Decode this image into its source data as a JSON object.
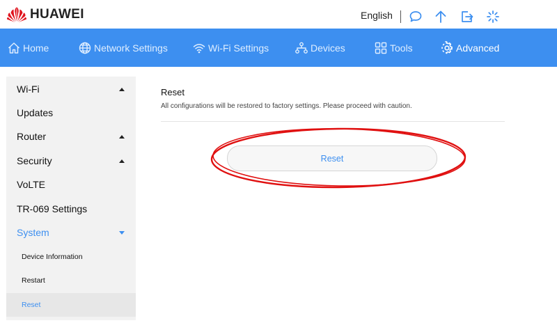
{
  "brand": {
    "name": "HUAWEI",
    "logo_color": "#e0141e"
  },
  "header": {
    "language": "English",
    "icons": [
      "chat-icon",
      "upload-arrow-icon",
      "logout-icon",
      "loading-spinner-icon"
    ]
  },
  "nav": {
    "items": [
      {
        "label": "Home",
        "icon": "home-icon"
      },
      {
        "label": "Network Settings",
        "icon": "globe-icon"
      },
      {
        "label": "Wi-Fi Settings",
        "icon": "wifi-icon"
      },
      {
        "label": "Devices",
        "icon": "devices-icon"
      },
      {
        "label": "Tools",
        "icon": "tools-grid-icon"
      },
      {
        "label": "Advanced",
        "icon": "gear-icon",
        "active": true
      }
    ]
  },
  "sidebar": {
    "items": [
      {
        "label": "Wi-Fi",
        "expandable": true
      },
      {
        "label": "Updates"
      },
      {
        "label": "Router",
        "expandable": true
      },
      {
        "label": "Security",
        "expandable": true
      },
      {
        "label": "VoLTE"
      },
      {
        "label": "TR-069 Settings"
      },
      {
        "label": "System",
        "expandable": true,
        "expanded": true
      }
    ],
    "sub_items": [
      {
        "label": "Device Information"
      },
      {
        "label": "Restart"
      },
      {
        "label": "Reset",
        "active": true
      }
    ]
  },
  "main": {
    "title": "Reset",
    "description": "All configurations will be restored to factory settings. Please proceed with caution.",
    "button_label": "Reset"
  },
  "colors": {
    "accent": "#3d8ff0",
    "annotation": "#e01010"
  }
}
